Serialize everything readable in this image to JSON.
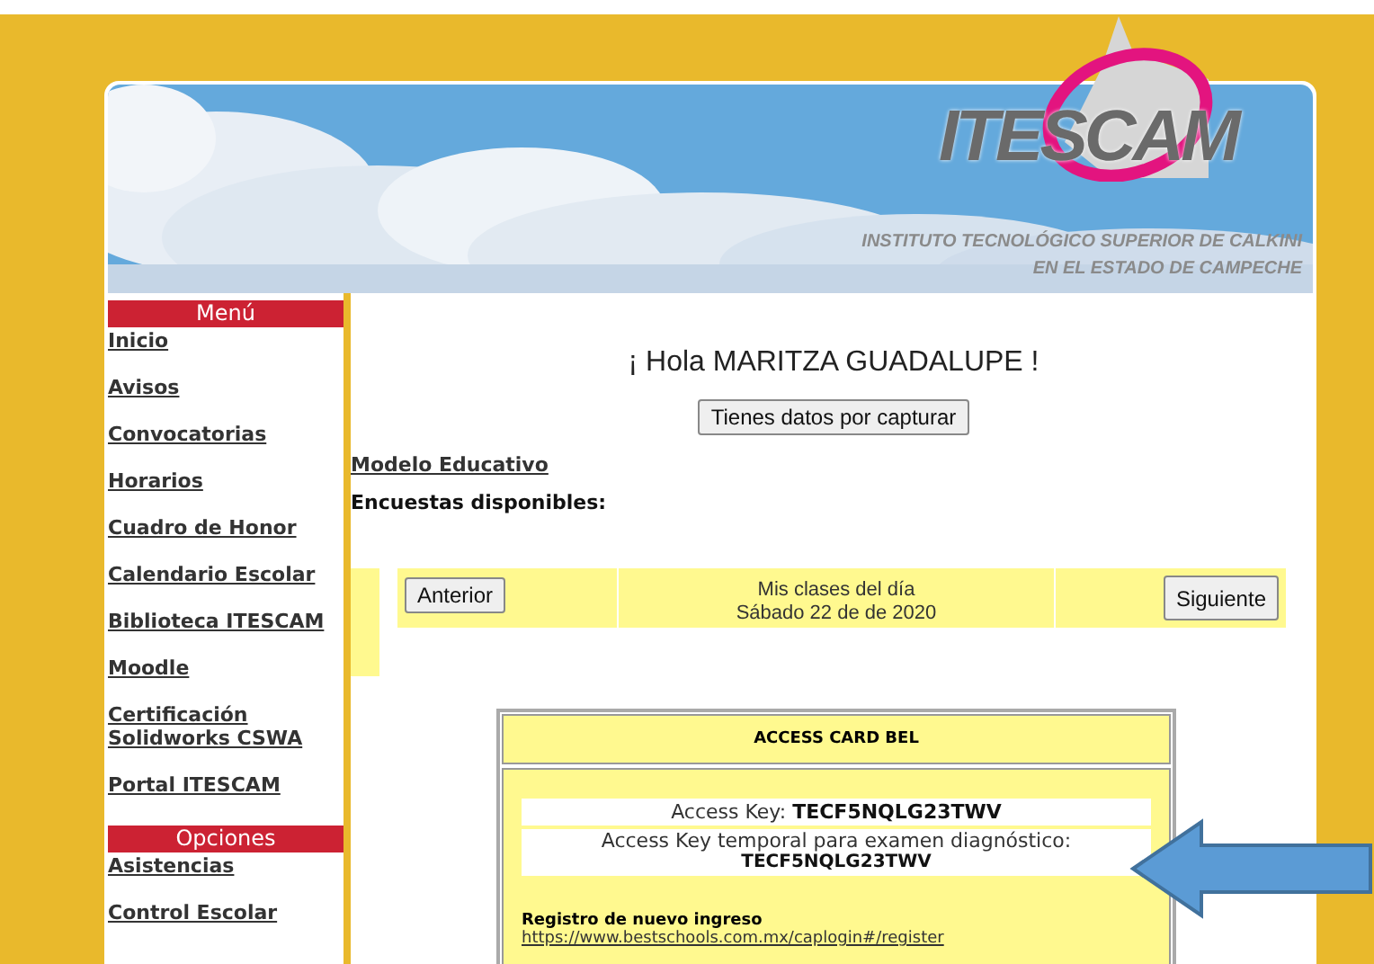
{
  "header": {
    "logo": "ITESCAM",
    "institute_lines": [
      "INSTITUTO TECNOLÓGICO SUPERIOR DE CALKINI",
      "EN EL ESTADO DE CAMPECHE"
    ]
  },
  "sidebar": {
    "sections": [
      {
        "title": "Menú",
        "items": [
          "Inicio",
          "Avisos",
          "Convocatorias",
          "Horarios",
          "Cuadro de Honor",
          "Calendario Escolar",
          "Biblioteca ITESCAM",
          "Moodle",
          "Certificación Solidworks CSWA",
          "Portal ITESCAM"
        ]
      },
      {
        "title": "Opciones",
        "items": [
          "Asistencias",
          "Control Escolar"
        ]
      }
    ]
  },
  "main": {
    "greeting": "¡ Hola MARITZA GUADALUPE !",
    "pending_button": "Tienes datos por capturar",
    "model_link": "Modelo Educativo",
    "surveys_label": "Encuestas disponibles:",
    "classes": {
      "prev_button": "Anterior",
      "title": "Mis clases del día",
      "date": "Sábado 22 de de 2020",
      "next_button": "Siguiente"
    },
    "access_card": {
      "title": "ACCESS CARD BEL",
      "key_label": "Access Key:",
      "key": "TECF5NQLG23TWV",
      "temp_label": "Access Key temporal para examen diagnóstico:",
      "temp_key": "TECF5NQLG23TWV",
      "register_title": "Registro de nuevo ingreso",
      "register_link": "https://www.bestschools.com.mx/caplogin#/register"
    }
  }
}
